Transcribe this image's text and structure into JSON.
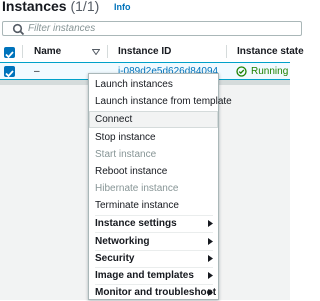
{
  "header": {
    "title": "Instances",
    "count": "(1/1)",
    "info_label": "Info"
  },
  "filter": {
    "placeholder": "Filter instances",
    "icon": "search-icon"
  },
  "table": {
    "columns": [
      "Name",
      "Instance ID",
      "Instance state"
    ],
    "rows": [
      {
        "selected": true,
        "name": "–",
        "instance_id": "i-089d2e5d626d84094",
        "state": "Running"
      }
    ]
  },
  "context_menu": {
    "items": [
      {
        "label": "Launch instances",
        "disabled": false,
        "bold": false,
        "submenu": false
      },
      {
        "label": "Launch instance from template",
        "disabled": false,
        "bold": false,
        "submenu": false
      },
      {
        "label": "Connect",
        "disabled": false,
        "bold": false,
        "submenu": false,
        "hover": true
      },
      {
        "label": "Stop instance",
        "disabled": false,
        "bold": false,
        "submenu": false
      },
      {
        "label": "Start instance",
        "disabled": true,
        "bold": false,
        "submenu": false
      },
      {
        "label": "Reboot instance",
        "disabled": false,
        "bold": false,
        "submenu": false
      },
      {
        "label": "Hibernate instance",
        "disabled": true,
        "bold": false,
        "submenu": false
      },
      {
        "label": "Terminate instance",
        "disabled": false,
        "bold": false,
        "submenu": false
      },
      {
        "label": "Instance settings",
        "disabled": false,
        "bold": true,
        "submenu": true
      },
      {
        "label": "Networking",
        "disabled": false,
        "bold": true,
        "submenu": true
      },
      {
        "label": "Security",
        "disabled": false,
        "bold": true,
        "submenu": true
      },
      {
        "label": "Image and templates",
        "disabled": false,
        "bold": true,
        "submenu": true
      },
      {
        "label": "Monitor and troubleshoot",
        "disabled": false,
        "bold": true,
        "submenu": true
      }
    ]
  },
  "colors": {
    "link": "#0073bb",
    "running": "#1d8102",
    "selected_row_bg": "#f1faff",
    "selected_row_border": "#00a1c9"
  }
}
